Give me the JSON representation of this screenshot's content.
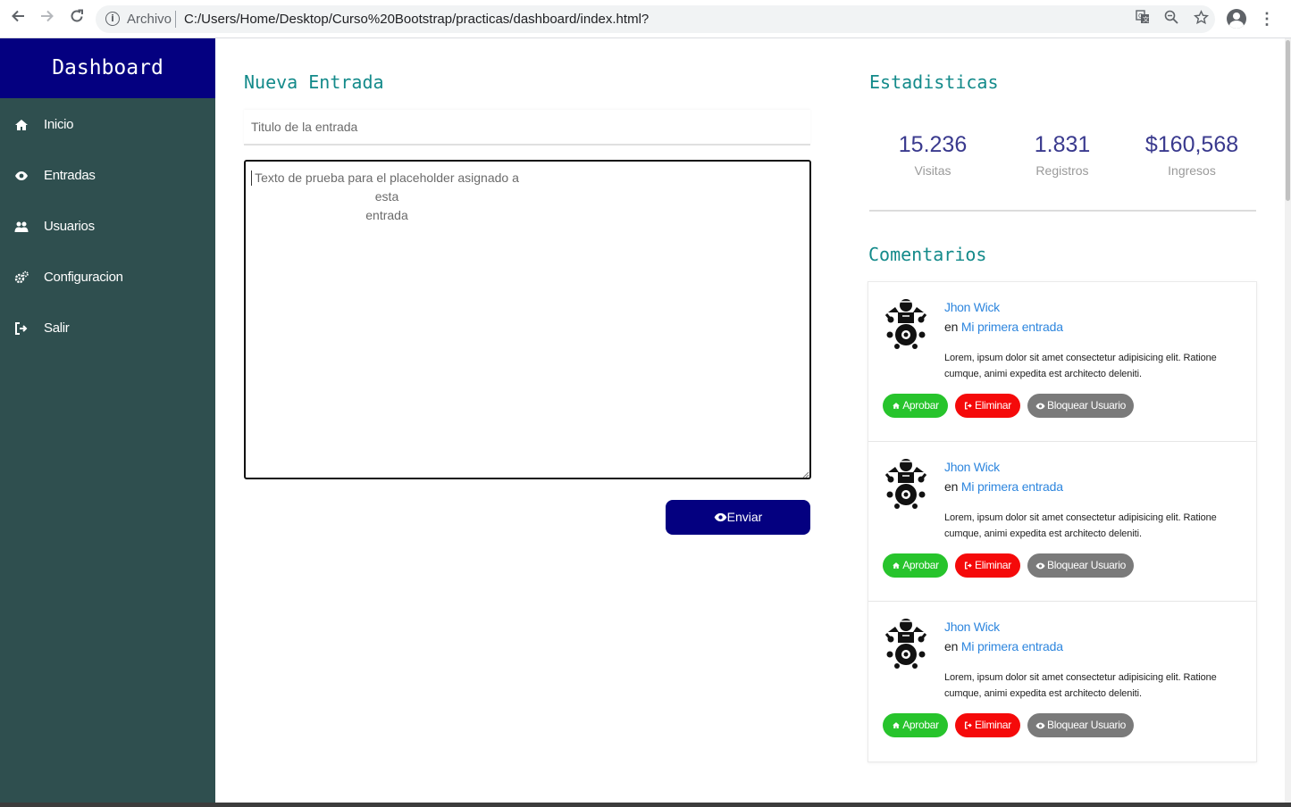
{
  "browser": {
    "url_scheme_label": "Archivo",
    "url": "C:/Users/Home/Desktop/Curso%20Bootstrap/practicas/dashboard/index.html?",
    "icons": [
      "back-arrow-icon",
      "forward-arrow-icon",
      "reload-icon",
      "info-icon",
      "translate-icon",
      "zoom-icon",
      "bookmark-star-icon",
      "profile-icon",
      "more-menu-icon"
    ]
  },
  "sidebar": {
    "brand": "Dashboard",
    "items": [
      {
        "label": "Inicio",
        "icon": "home-icon"
      },
      {
        "label": "Entradas",
        "icon": "eye-icon"
      },
      {
        "label": "Usuarios",
        "icon": "users-icon"
      },
      {
        "label": "Configuracion",
        "icon": "cogs-icon"
      },
      {
        "label": "Salir",
        "icon": "sign-out-icon"
      }
    ]
  },
  "new_entry": {
    "title": "Nueva Entrada",
    "title_placeholder": "Titulo de la entrada",
    "body_line1": "Texto de prueba para el placeholder asignado a esta",
    "body_line2": "entrada",
    "send_label": "Enviar"
  },
  "stats": {
    "title": "Estadisticas",
    "items": [
      {
        "value": "15.236",
        "label": "Visitas"
      },
      {
        "value": "1.831",
        "label": "Registros"
      },
      {
        "value": "$160,568",
        "label": "Ingresos"
      }
    ]
  },
  "comments": {
    "title": "Comentarios",
    "items": [
      {
        "author": "Jhon Wick",
        "prefix": "en",
        "post": "Mi primera entrada",
        "text": "Lorem, ipsum dolor sit amet consectetur adipisicing elit. Ratione cumque, animi expedita est architecto deleniti.",
        "approve": "Aprobar",
        "delete": "Eliminar",
        "block": "Bloquear Usuario"
      },
      {
        "author": "Jhon Wick",
        "prefix": "en",
        "post": "Mi primera entrada",
        "text": "Lorem, ipsum dolor sit amet consectetur adipisicing elit. Ratione cumque, animi expedita est architecto deleniti.",
        "approve": "Aprobar",
        "delete": "Eliminar",
        "block": "Bloquear Usuario"
      },
      {
        "author": "Jhon Wick",
        "prefix": "en",
        "post": "Mi primera entrada",
        "text": "Lorem, ipsum dolor sit amet consectetur adipisicing elit. Ratione cumque, animi expedita est architecto deleniti.",
        "approve": "Aprobar",
        "delete": "Eliminar",
        "block": "Bloquear Usuario"
      }
    ]
  },
  "colors": {
    "brand_navy": "#040080",
    "sidebar_slate": "#2f4f4f",
    "heading_teal": "#138a8a",
    "link_blue": "#2e86de",
    "approve_green": "#27c42c",
    "delete_red": "#f50a0a",
    "block_gray": "#7a7a7a"
  }
}
